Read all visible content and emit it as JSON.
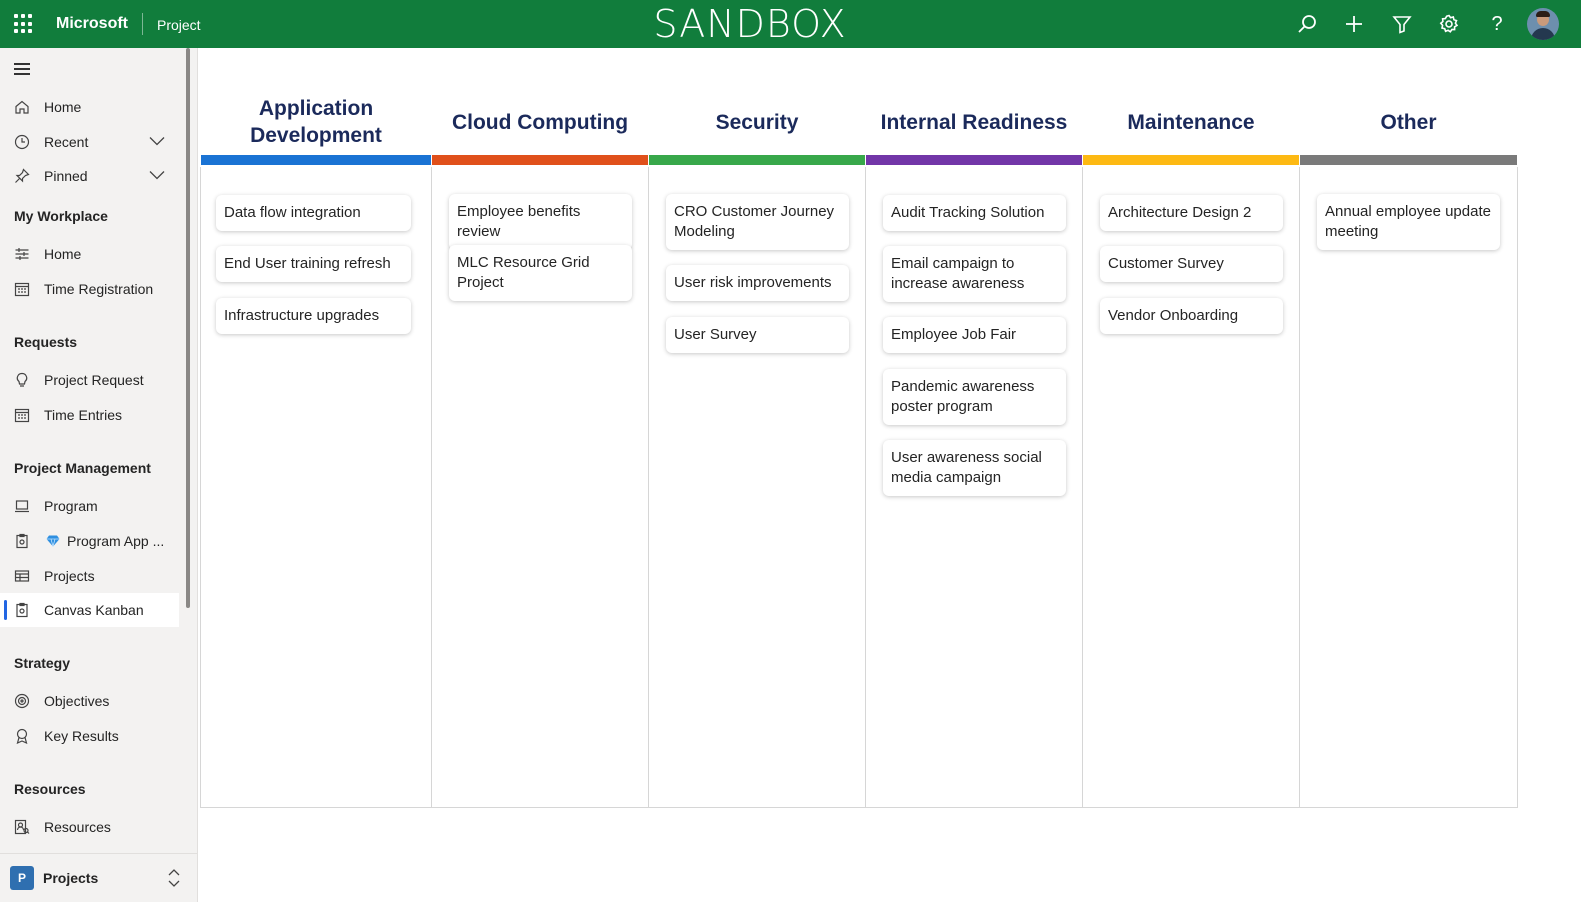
{
  "topbar": {
    "brand": "Microsoft",
    "app_name": "Project",
    "environment_title": "SANDBOX",
    "icons": [
      "search-icon",
      "add-icon",
      "filter-icon",
      "settings-icon",
      "help-icon"
    ],
    "help_glyph": "?"
  },
  "sidebar": {
    "items_top": [
      {
        "label": "Home",
        "icon": "home-icon"
      },
      {
        "label": "Recent",
        "icon": "clock-icon"
      },
      {
        "label": "Pinned",
        "icon": "pin-icon"
      }
    ],
    "sections": [
      {
        "title": "My Workplace",
        "items": [
          {
            "label": "Home"
          },
          {
            "label": "Time Registration"
          }
        ]
      },
      {
        "title": "Requests",
        "items": [
          {
            "label": "Project Request"
          },
          {
            "label": "Time Entries"
          }
        ]
      },
      {
        "title": "Project Management",
        "items": [
          {
            "label": "Program"
          },
          {
            "label": "Program App ..."
          },
          {
            "label": "Projects"
          },
          {
            "label": "Canvas Kanban"
          }
        ]
      },
      {
        "title": "Strategy",
        "items": [
          {
            "label": "Objectives"
          },
          {
            "label": "Key Results"
          }
        ]
      },
      {
        "title": "Resources",
        "items": [
          {
            "label": "Resources"
          }
        ]
      }
    ],
    "selected": "Canvas Kanban",
    "area": {
      "badge": "P",
      "label": "Projects"
    }
  },
  "board": {
    "columns": [
      {
        "title": "Application Development",
        "color": "#1a73d4",
        "cards": [
          "Data flow integration",
          "End User training refresh",
          "Infrastructure upgrades"
        ]
      },
      {
        "title": "Cloud Computing",
        "color": "#e0501b",
        "cards": [
          "Employee benefits review",
          "MLC Resource Grid Project"
        ]
      },
      {
        "title": "Security",
        "color": "#38a84a",
        "cards": [
          "CRO Customer Journey Modeling",
          "User risk improvements",
          "User Survey"
        ]
      },
      {
        "title": "Internal Readiness",
        "color": "#7236a8",
        "cards": [
          "Audit Tracking Solution",
          "Email campaign to increase awareness",
          "Employee Job Fair",
          "Pandemic awareness poster program",
          "User awareness social media campaign"
        ]
      },
      {
        "title": "Maintenance",
        "color": "#fdb913",
        "cards": [
          "Architecture Design 2",
          "Customer Survey",
          "Vendor Onboarding"
        ]
      },
      {
        "title": "Other",
        "color": "#7a7a7a",
        "cards": [
          "Annual employee update meeting"
        ]
      }
    ]
  }
}
